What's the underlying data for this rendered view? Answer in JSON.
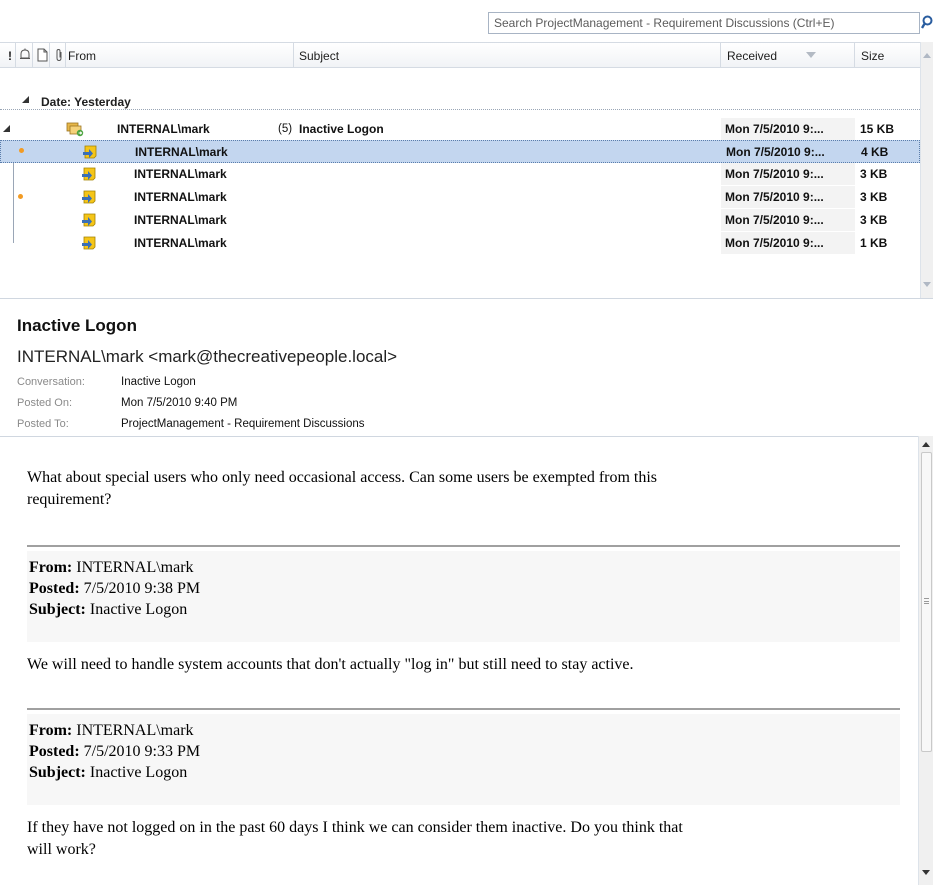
{
  "search": {
    "placeholder": "Search ProjectManagement - Requirement Discussions (Ctrl+E)"
  },
  "columns": {
    "importance": "!",
    "from": "From",
    "subject": "Subject",
    "received": "Received",
    "size": "Size"
  },
  "group": {
    "label": "Date: Yesterday"
  },
  "conversation": {
    "from": "INTERNAL\\mark",
    "count": "(5)",
    "subject": "Inactive Logon",
    "received": "Mon 7/5/2010 9:...",
    "size": "15 KB"
  },
  "messages": [
    {
      "from": "INTERNAL\\mark",
      "received": "Mon 7/5/2010 9:...",
      "size": "4 KB"
    },
    {
      "from": "INTERNAL\\mark",
      "received": "Mon 7/5/2010 9:...",
      "size": "3 KB"
    },
    {
      "from": "INTERNAL\\mark",
      "received": "Mon 7/5/2010 9:...",
      "size": "3 KB"
    },
    {
      "from": "INTERNAL\\mark",
      "received": "Mon 7/5/2010 9:...",
      "size": "3 KB"
    },
    {
      "from": "INTERNAL\\mark",
      "received": "Mon 7/5/2010 9:...",
      "size": "1 KB"
    }
  ],
  "reading": {
    "subject": "Inactive Logon",
    "sender": "INTERNAL\\mark <mark@thecreativepeople.local>",
    "labels": {
      "conversation": "Conversation:",
      "posted_on": "Posted On:",
      "posted_to": "Posted To:"
    },
    "conversation": "Inactive Logon",
    "posted_on": "Mon 7/5/2010 9:40 PM",
    "posted_to": "ProjectManagement - Requirement Discussions",
    "body": {
      "intro_1": "What about special users who only need occasional access. Can some users be exempted from this",
      "intro_2": "requirement?",
      "quote_labels": {
        "from": "From:",
        "posted": "Posted:",
        "subject": "Subject:"
      },
      "quotes": [
        {
          "from": "INTERNAL\\mark",
          "posted": "7/5/2010 9:38 PM",
          "subject": "Inactive Logon",
          "text_1": "We will need to handle system accounts that don't actually \"log in\" but still need to stay active.",
          "text_2": ""
        },
        {
          "from": "INTERNAL\\mark",
          "posted": "7/5/2010 9:33 PM",
          "subject": "Inactive Logon",
          "text_1": "If they have not logged on in the past 60 days I think we can consider them inactive.  Do you think that",
          "text_2": "will work?"
        }
      ]
    }
  },
  "colors": {
    "selection": "#c3d6ef",
    "thread_dot": "#f29b24",
    "search_icon": "#2a5d9f",
    "post_icon": "#f5c518"
  }
}
